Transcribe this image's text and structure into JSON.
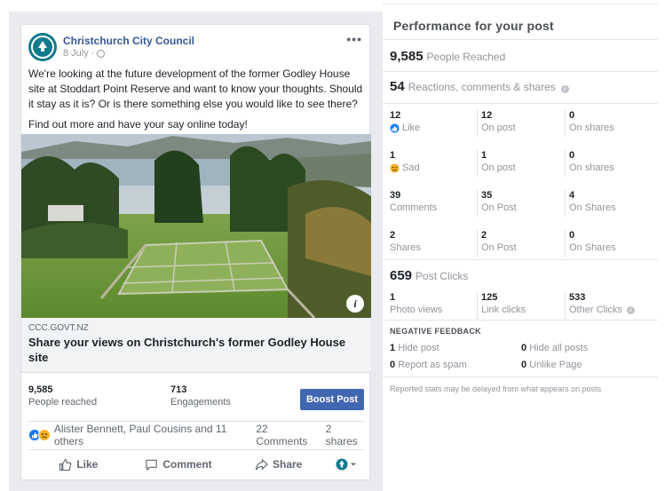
{
  "post": {
    "page_name": "Christchurch City Council",
    "date": "8 July",
    "date_sep": "·",
    "more": "•••",
    "paragraph1": "We're looking at the future development of the former Godley House site at Stoddart Point Reserve and want to know your thoughts. Should it stay as it is? Or is there something else you would like to see there?",
    "paragraph2": "Find out more and have your say online today!",
    "info_glyph": "i",
    "link_domain": "CCC.GOVT.NZ",
    "link_title": "Share your views on Christchurch's former Godley House site"
  },
  "stats": {
    "reached_value": "9,585",
    "reached_label": "People reached",
    "engagements_value": "713",
    "engagements_label": "Engagements",
    "boost_label": "Boost Post"
  },
  "reactions": {
    "names": "Alister Bennett, Paul Cousins and 11 others",
    "comments": "22 Comments",
    "shares": "2 shares"
  },
  "actions": {
    "like": "Like",
    "comment": "Comment",
    "share": "Share"
  },
  "performance": {
    "title": "Performance for your post",
    "reached_value": "9,585",
    "reached_label": "People Reached",
    "reactions_value": "54",
    "reactions_label": "Reactions, comments & shares",
    "rows": [
      {
        "c1n": "12",
        "c1l": "Like",
        "c2n": "12",
        "c2l": "On post",
        "c3n": "0",
        "c3l": "On shares"
      },
      {
        "c1n": "1",
        "c1l": "Sad",
        "c2n": "1",
        "c2l": "On post",
        "c3n": "0",
        "c3l": "On shares"
      },
      {
        "c1n": "39",
        "c1l": "Comments",
        "c2n": "35",
        "c2l": "On Post",
        "c3n": "4",
        "c3l": "On Shares"
      },
      {
        "c1n": "2",
        "c1l": "Shares",
        "c2n": "2",
        "c2l": "On Post",
        "c3n": "0",
        "c3l": "On Shares"
      }
    ],
    "clicks_value": "659",
    "clicks_label": "Post Clicks",
    "clicks": {
      "c1n": "1",
      "c1l": "Photo views",
      "c2n": "125",
      "c2l": "Link clicks",
      "c3n": "533",
      "c3l": "Other Clicks"
    },
    "negative_title": "NEGATIVE FEEDBACK",
    "hide_post_value": "1",
    "hide_post_label": "Hide post",
    "hide_all_value": "0",
    "hide_all_label": "Hide all posts",
    "spam_value": "0",
    "spam_label": "Report as spam",
    "unlike_value": "0",
    "unlike_label": "Unlike Page",
    "disclaimer": "Reported stats may be delayed from what appears on posts"
  },
  "colors": {
    "link_blue": "#385898",
    "boost_blue": "#4267b2",
    "teal_avatar": "#0f7a8c"
  }
}
